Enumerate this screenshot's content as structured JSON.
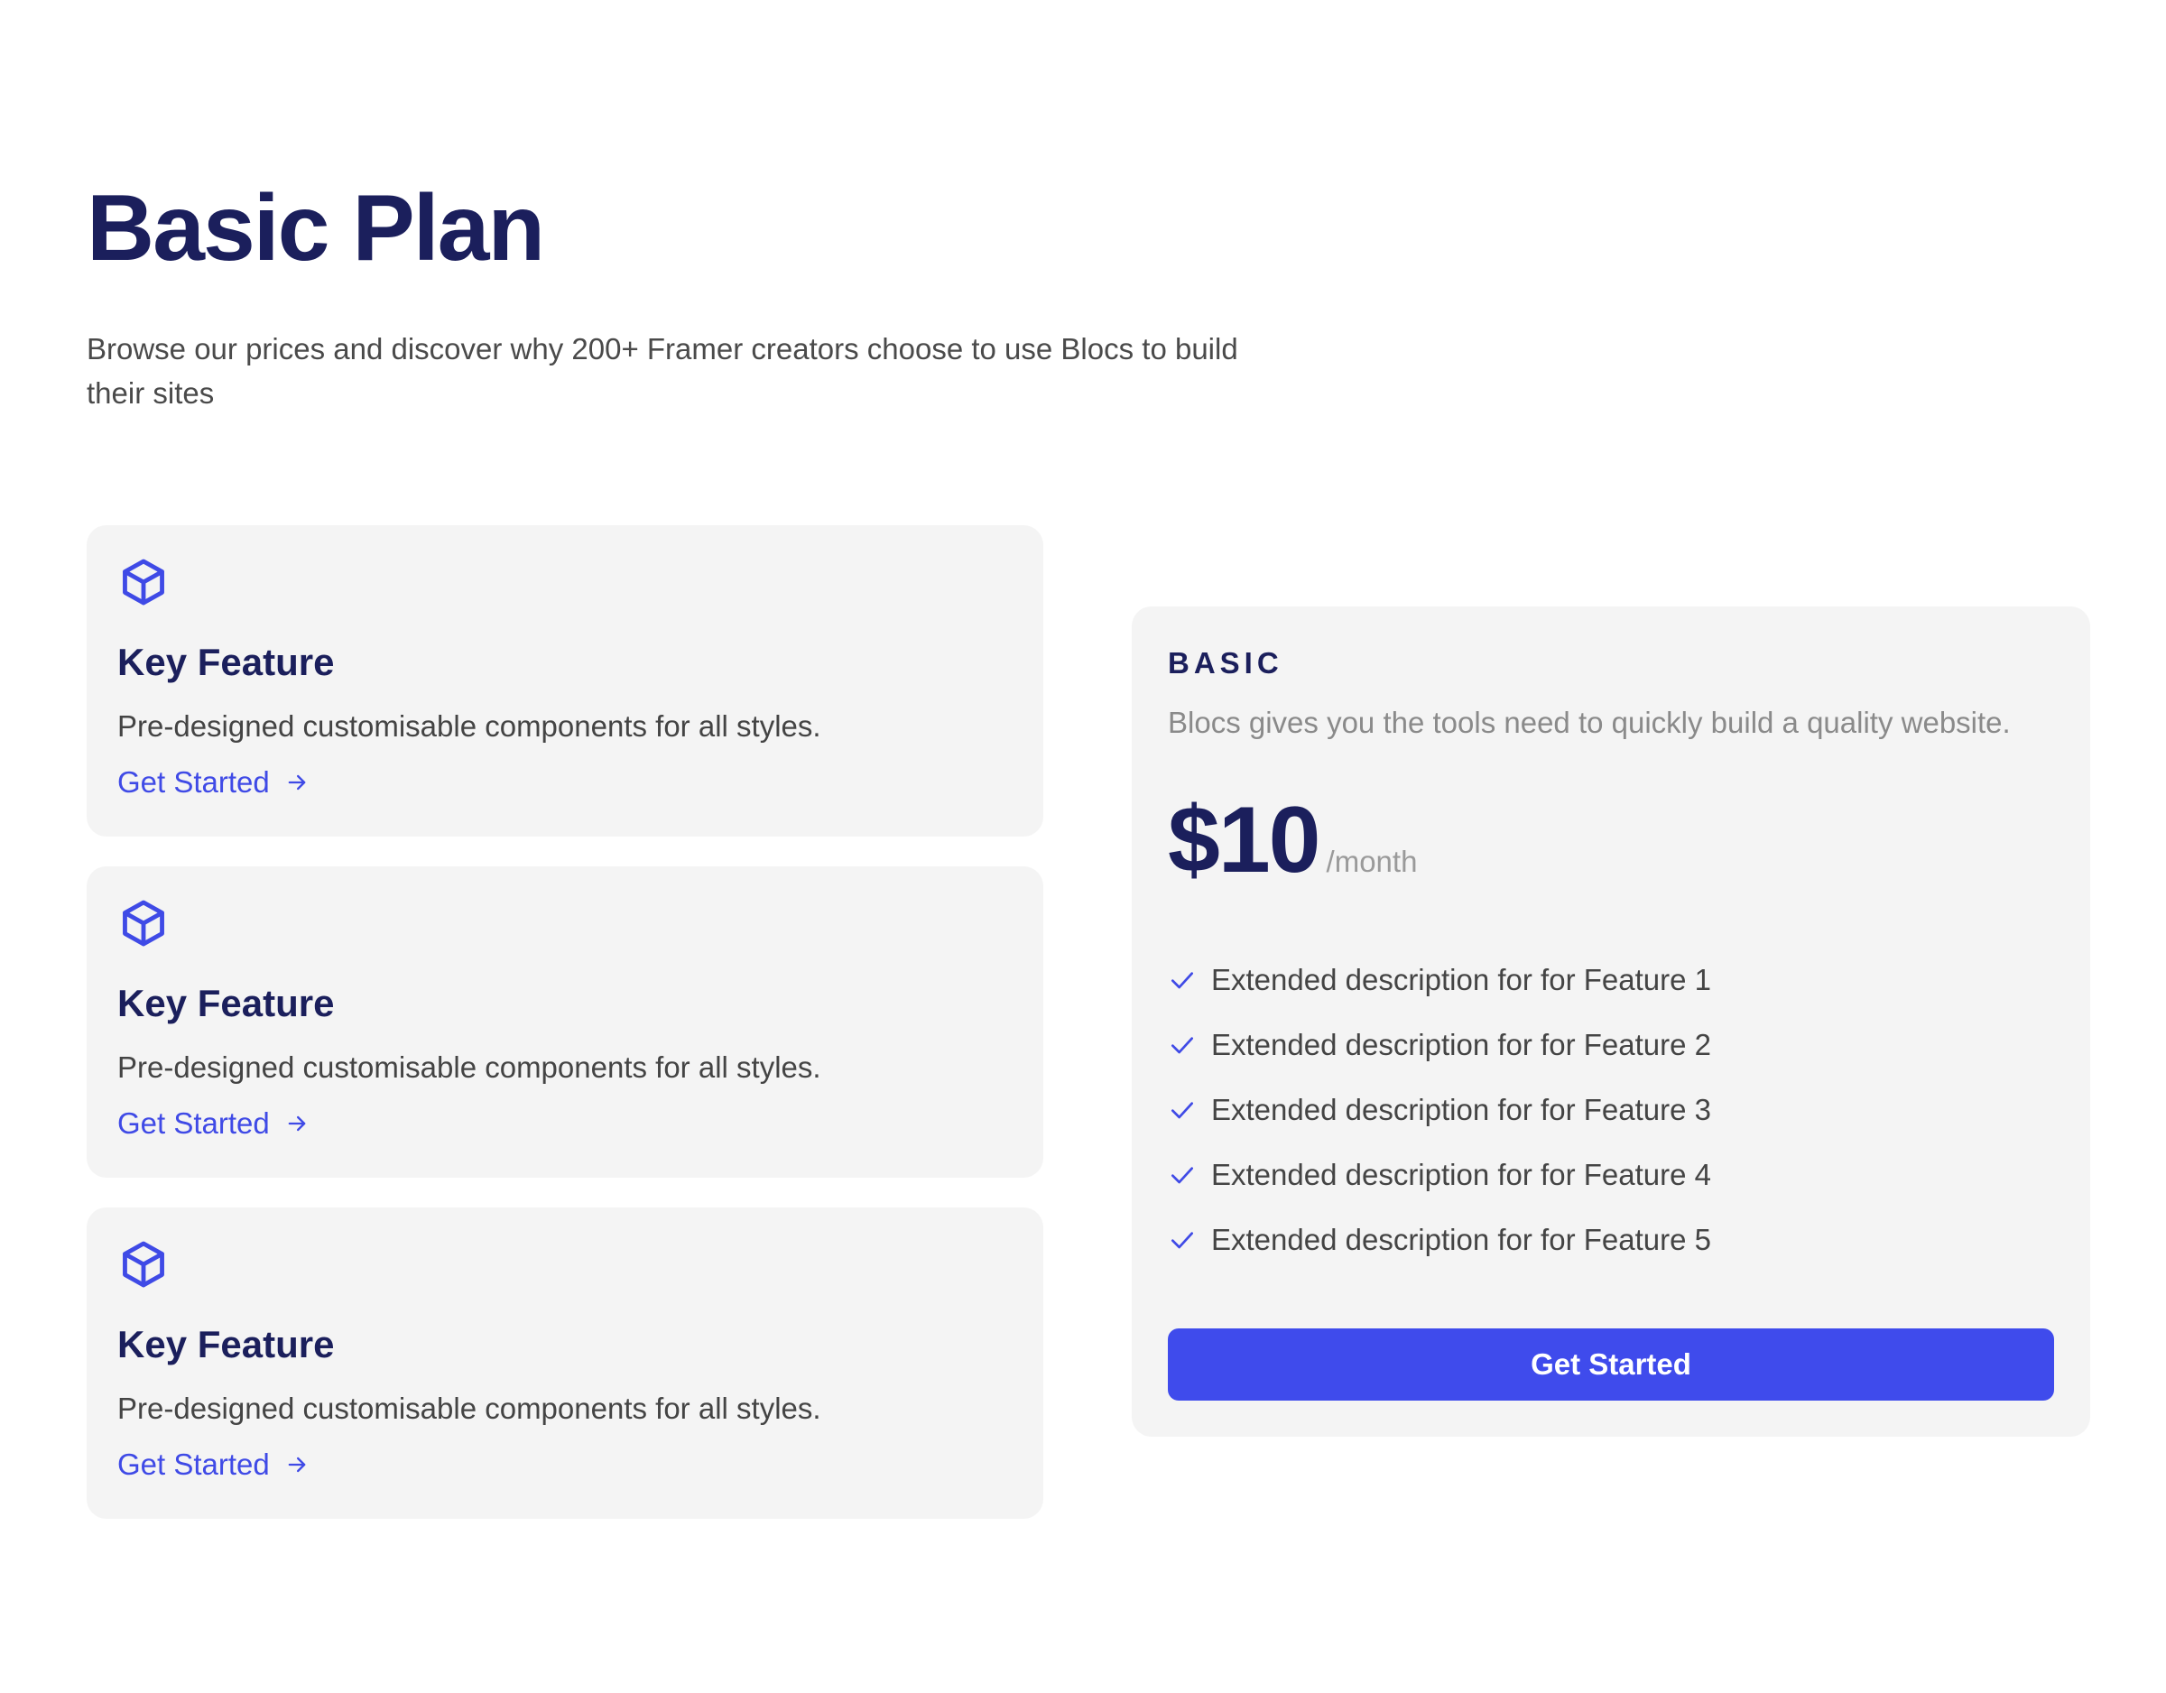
{
  "header": {
    "title": "Basic Plan",
    "subtitle": "Browse our prices and discover why 200+ Framer creators choose to use Blocs to build their sites"
  },
  "features": [
    {
      "icon": "cube-icon",
      "title": "Key Feature",
      "description": "Pre-designed customisable components for all styles.",
      "link_label": "Get Started",
      "link_icon": "arrow-right-icon"
    },
    {
      "icon": "cube-icon",
      "title": "Key Feature",
      "description": "Pre-designed customisable components for all styles.",
      "link_label": "Get Started",
      "link_icon": "arrow-right-icon"
    },
    {
      "icon": "cube-icon",
      "title": "Key Feature",
      "description": "Pre-designed customisable components for all styles.",
      "link_label": "Get Started",
      "link_icon": "arrow-right-icon"
    }
  ],
  "pricing": {
    "plan_name": "BASIC",
    "description": "Blocs gives you the tools need to quickly build a quality website.",
    "price": "$10",
    "period": "/month",
    "check_icon": "check-icon",
    "items": [
      "Extended description for for Feature 1",
      "Extended description for for Feature 2",
      "Extended description for for Feature 3",
      "Extended description for for Feature 4",
      "Extended description for for Feature 5"
    ],
    "button_label": "Get Started"
  },
  "colors": {
    "heading": "#1b1f5c",
    "accent": "#3f4bec",
    "card_background": "#f4f4f4",
    "body_text": "#444444",
    "muted_text": "#8a8a8a"
  }
}
